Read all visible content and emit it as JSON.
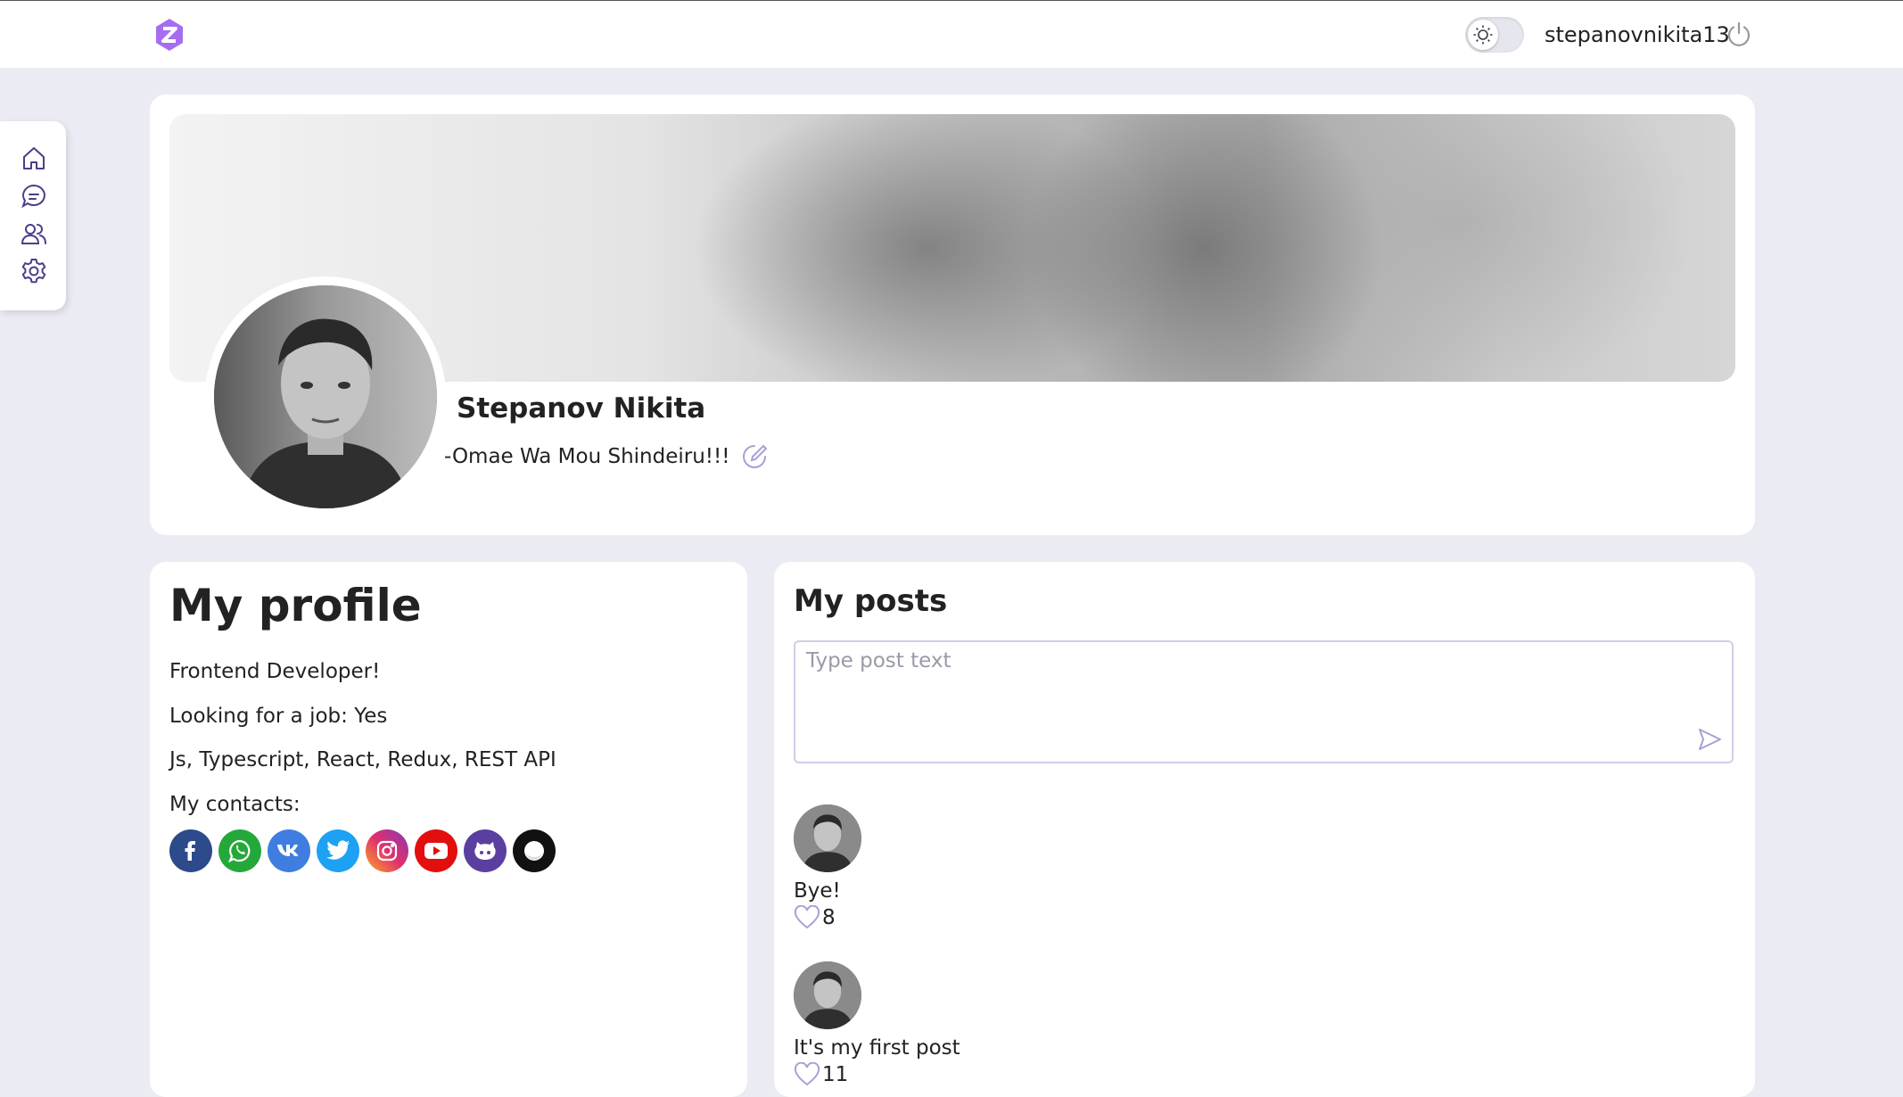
{
  "header": {
    "logo_icon": "logo-icon",
    "theme_toggle_icon": "sun-icon",
    "username": "stepanovnikita13",
    "logout_icon": "power-icon"
  },
  "sidebar": {
    "items": [
      {
        "icon": "home-icon"
      },
      {
        "icon": "chat-icon"
      },
      {
        "icon": "users-icon"
      },
      {
        "icon": "gear-icon"
      }
    ]
  },
  "profile_header": {
    "name": "Stepanov Nikita",
    "status": "-Omae Wa Mou Shindeiru!!!"
  },
  "my_profile": {
    "title": "My profile",
    "about": "Frontend Developer!",
    "looking_for_job": "Looking for a job: Yes",
    "skills": "Js, Typescript, React, Redux, REST API",
    "contacts_label": "My contacts:",
    "contacts": [
      {
        "icon": "facebook-icon",
        "color": "#2d4a8a"
      },
      {
        "icon": "whatsapp-icon",
        "color": "#25a83a"
      },
      {
        "icon": "vk-icon",
        "color": "#3f7ee0"
      },
      {
        "icon": "twitter-icon",
        "color": "#1da1f2"
      },
      {
        "icon": "instagram-icon",
        "color": "#c13584"
      },
      {
        "icon": "youtube-icon",
        "color": "#e30e0e"
      },
      {
        "icon": "github-icon",
        "color": "#5b3fa0"
      },
      {
        "icon": "website-icon",
        "color": "#111111"
      }
    ]
  },
  "my_posts": {
    "title": "My posts",
    "input_placeholder": "Type post text",
    "posts": [
      {
        "text": "Bye!",
        "likes": "8"
      },
      {
        "text": "It's my first post",
        "likes": "11"
      }
    ]
  },
  "colors": {
    "accent": "#8b5cf6",
    "background": "#ebebf3",
    "icon_stroke": "#4a3f8a"
  }
}
